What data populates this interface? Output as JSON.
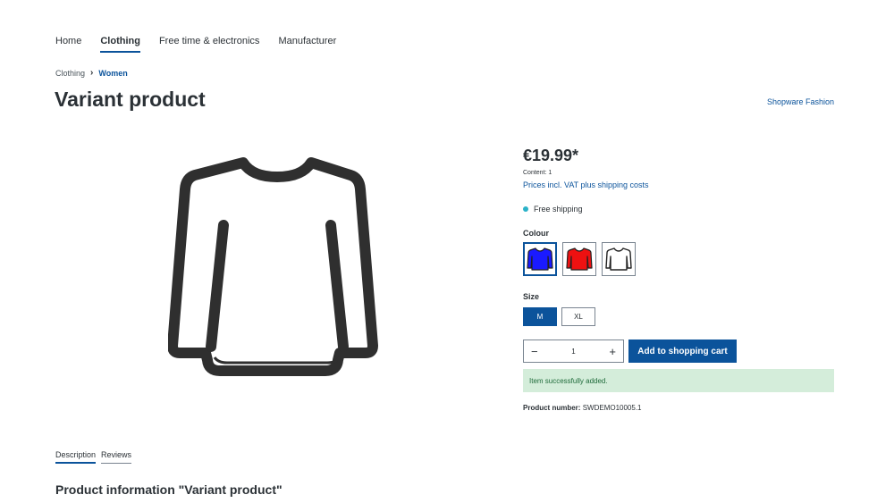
{
  "nav": {
    "items": [
      {
        "label": "Home",
        "active": false
      },
      {
        "label": "Clothing",
        "active": true
      },
      {
        "label": "Free time & electronics",
        "active": false
      },
      {
        "label": "Manufacturer",
        "active": false
      }
    ]
  },
  "breadcrumb": {
    "parent": "Clothing",
    "separator": "›",
    "current": "Women"
  },
  "product": {
    "title": "Variant product",
    "manufacturer": "Shopware Fashion",
    "image_icon": "long-sleeve-shirt-icon",
    "price": "€19.99*",
    "content": "Content: 1",
    "vat_link": "Prices incl. VAT plus shipping costs",
    "delivery": "Free shipping",
    "delivery_color": "#2bb2c8",
    "product_number_label": "Product number:",
    "product_number_value": "SWDEMO10005.1"
  },
  "configurator": {
    "colour_label": "Colour",
    "colours": [
      {
        "name": "blue",
        "hex": "#1a1aff",
        "selected": true
      },
      {
        "name": "red",
        "hex": "#ee1111",
        "selected": false
      },
      {
        "name": "white",
        "hex": "#ffffff",
        "selected": false
      }
    ],
    "size_label": "Size",
    "sizes": [
      {
        "label": "M",
        "selected": true
      },
      {
        "label": "XL",
        "selected": false
      }
    ]
  },
  "cart": {
    "quantity": "1",
    "minus": "−",
    "plus": "+",
    "button_label": "Add to shopping cart",
    "success_message": "Item successfully added."
  },
  "tabs": [
    {
      "label": "Description",
      "active": true
    },
    {
      "label": "Reviews",
      "active": false
    }
  ],
  "section": {
    "title": "Product information \"Variant product\""
  },
  "colors": {
    "primary": "#0b539b",
    "text": "#2b3136",
    "success_bg": "#d4edda",
    "success_text": "#1f6b3a"
  }
}
